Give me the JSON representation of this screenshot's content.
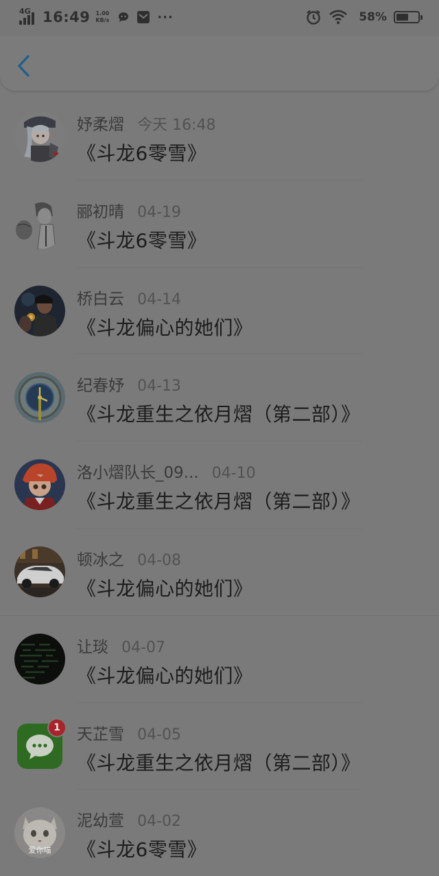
{
  "status_bar": {
    "network": "4G",
    "time": "16:49",
    "speed_value": "1.00",
    "speed_unit": "KB/s",
    "battery_percent": "58%",
    "battery_level": 0.58,
    "icons": [
      "signal-icon",
      "chat-notification-icon",
      "mail-notification-icon",
      "more-dots-icon",
      "alarm-icon",
      "wifi-icon",
      "battery-icon"
    ]
  },
  "nav": {
    "back_icon": "chevron-left-icon",
    "accent": "#1f5e8a"
  },
  "items": [
    {
      "name": "妤柔熠",
      "date": "今天 16:48",
      "title": "《斗龙6零雪》",
      "avatar": "anime-girl-avatar"
    },
    {
      "name": "郦初晴",
      "date": "04-19",
      "title": "《斗龙6零雪》",
      "avatar": "sketch-boy-avatar"
    },
    {
      "name": "桥白云",
      "date": "04-14",
      "title": "《斗龙偏心的她们》",
      "avatar": "couple-photo-avatar"
    },
    {
      "name": "纪春妤",
      "date": "04-13",
      "title": "《斗龙重生之依月熠（第二部）》",
      "avatar": "clock-tower-avatar"
    },
    {
      "name": "洛小熠队长_09...",
      "date": "04-10",
      "title": "《斗龙重生之依月熠（第二部）》",
      "avatar": "red-hair-boy-avatar"
    },
    {
      "name": "顿冰之",
      "date": "04-08",
      "title": "《斗龙偏心的她们》",
      "avatar": "sports-car-avatar"
    },
    {
      "name": "让琰",
      "date": "04-07",
      "title": "《斗龙偏心的她们》",
      "avatar": "dark-code-avatar"
    },
    {
      "name": "天芷雪",
      "date": "04-05",
      "title": "《斗龙重生之依月熠（第二部）》",
      "avatar": "wechat-app-avatar",
      "badge": "1"
    },
    {
      "name": "泥幼萱",
      "date": "04-02",
      "title": "《斗龙6零雪》",
      "avatar": "cat-photo-avatar",
      "avatar_text": "爱你喵"
    }
  ]
}
